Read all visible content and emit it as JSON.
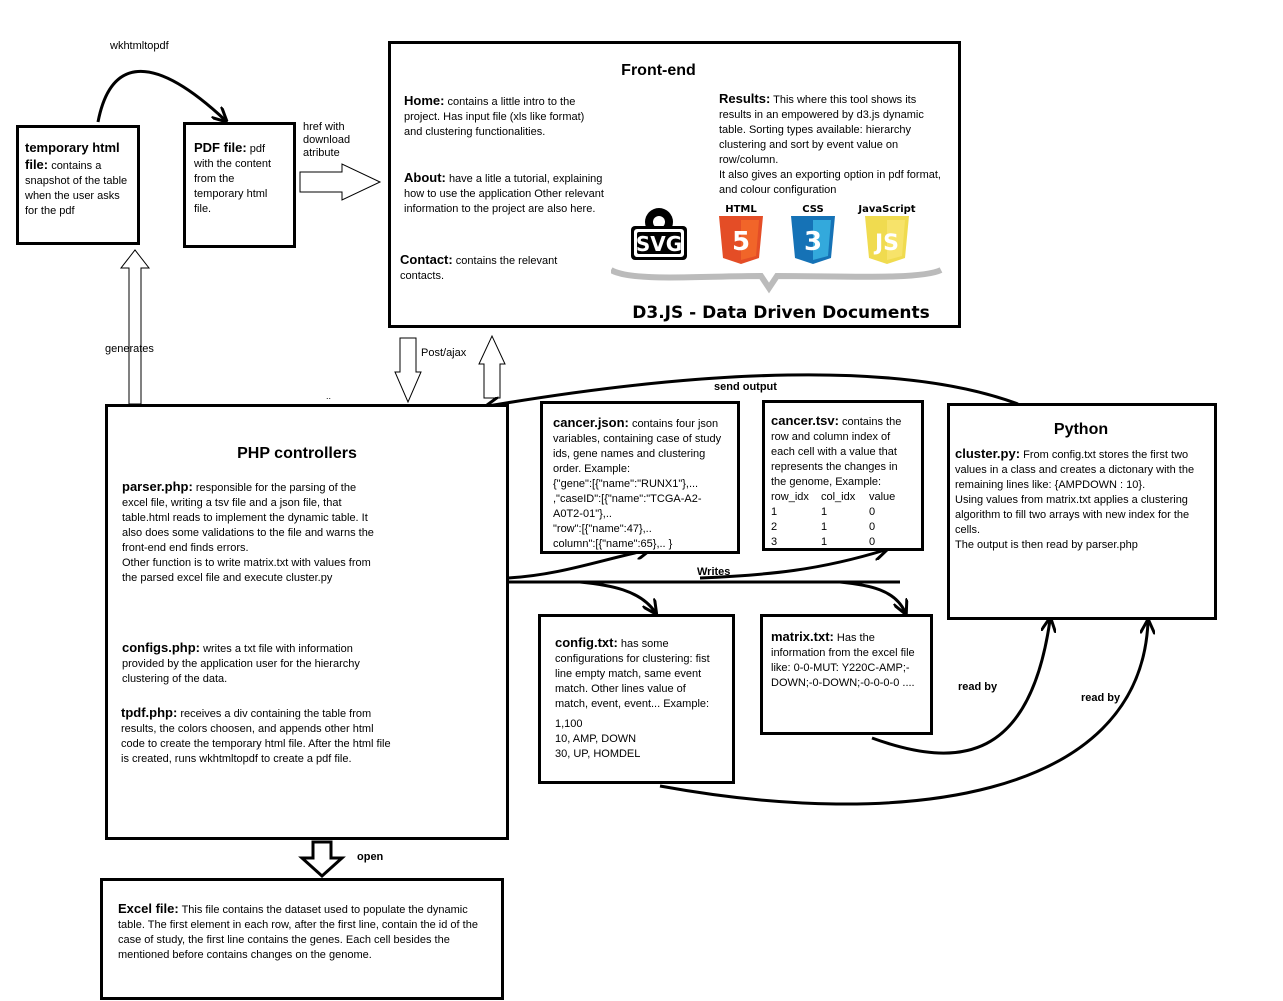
{
  "temp_html": {
    "title": "temporary html file:",
    "text": "contains a snapshot of the table when the user asks for the pdf"
  },
  "pdf_file": {
    "title": "PDF file:",
    "text": "pdf with the content from the temporary html file."
  },
  "labels": {
    "wkhtmltopdf": "wkhtmltopdf",
    "href": "href with download atribute",
    "generates": "generates",
    "post_ajax": "Post/ajax",
    "send_output": "send output",
    "writes": "Writes",
    "read_by_1": "read by",
    "read_by_2": "read by",
    "open": "open",
    "dots": ".."
  },
  "frontend": {
    "title": "Front-end",
    "home_title": "Home:",
    "home_text": "contains a little intro to the project. Has input file (xls like format) and clustering functionalities.",
    "about_title": "About:",
    "about_text": "have a litle a tutorial, explaining how to use the application Other relevant information to the project are also here.",
    "contact_title": "Contact:",
    "contact_text": "contains the relevant contacts.",
    "results_title": "Results:",
    "results_text": "This where this tool shows its results in an empowered by d3.js dynamic table. Sorting types available: hierarchy clustering and sort by event value on row/column.",
    "results_text2": "It also gives an exporting option in pdf format, and colour configuration",
    "logo_svg": "SVG",
    "logo_html_top": "HTML",
    "logo_html": "5",
    "logo_css_top": "CSS",
    "logo_css": "3",
    "logo_js_top": "JavaScript",
    "logo_js": "JS",
    "d3_banner": "D3.JS - Data Driven Documents",
    "colors": {
      "html5": "#e44d26",
      "css3": "#1572b6",
      "js": "#f0db4f",
      "svg": "#000000"
    }
  },
  "php": {
    "title": "PHP controllers",
    "parser_title": "parser.php:",
    "parser_text": "responsible for the parsing of the excel file, writing a tsv file and a json file, that table.html reads to implement the dynamic table. It also does some validations to the file and warns the front-end end finds errors.",
    "parser_text2": "Other function is to write matrix.txt with values from the parsed excel file and execute cluster.py",
    "configs_title": "configs.php:",
    "configs_text": "writes a txt file with information provided by the application user for the hierarchy clustering of the data.",
    "tpdf_title": "tpdf.php:",
    "tpdf_text": "receives a div containing the table from results, the colors choosen, and appends other html code to create the temporary html file. After the html file is created, runs wkhtmltopdf to create a pdf file."
  },
  "cancer_json": {
    "title": "cancer.json:",
    "text": "contains four json variables, containing case of study ids, gene names and clustering order. Example:",
    "ex1": "{\"gene\":[{\"name\":\"RUNX1\"},...",
    "ex2": ",\"caseID\":[{\"name\":\"TCGA-A2-A0T2-01\"},..",
    "ex3": "\"row\":[{\"name\":47},..",
    "ex4": "column\":[{\"name\":65},.. }"
  },
  "cancer_tsv": {
    "title": "cancer.tsv:",
    "text": "contains the row and column index of each cell with a value that represents the changes in the genome, Example:",
    "headers": [
      "row_idx",
      "col_idx",
      "value"
    ],
    "rows": [
      [
        "1",
        "1",
        "0"
      ],
      [
        "2",
        "1",
        "0"
      ],
      [
        "3",
        "1",
        "0"
      ]
    ]
  },
  "python": {
    "title": "Python",
    "cluster_title": "cluster.py:",
    "cluster_text": "From config.txt stores the first two values in a class and creates a dictonary with the remaining lines like: {AMPDOWN : 10}.",
    "cluster_text2": "Using values from matrix.txt applies a clustering algorithm to fill two arrays with new index for the cells.",
    "cluster_text3": "The output is then read by parser.php"
  },
  "config_txt": {
    "title": "config.txt:",
    "text": "has some configurations for clustering: fist line empty match, same event match. Other lines value of match, event, event... Example:",
    "lines": [
      "1,100",
      "10, AMP, DOWN",
      "30, UP, HOMDEL"
    ]
  },
  "matrix_txt": {
    "title": "matrix.txt:",
    "text": "Has the information from the excel file like: 0-0-MUT: Y220C-AMP;-DOWN;-0-DOWN;-0-0-0-0 ...."
  },
  "excel": {
    "title": "Excel file:",
    "text": "This file contains the dataset used to populate the dynamic table. The first element in each row, after the first line, contain the id of the case of study, the first line contains the genes. Each cell besides the mentioned before contains changes on the genome."
  }
}
